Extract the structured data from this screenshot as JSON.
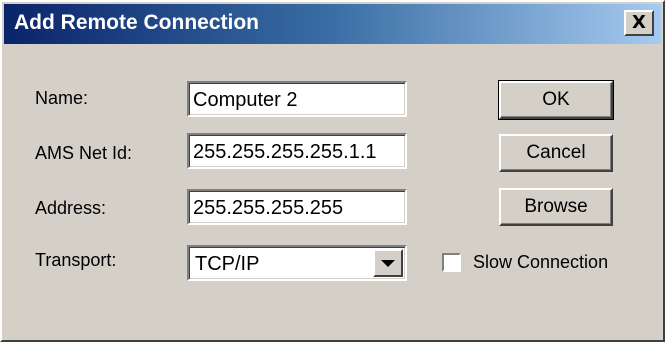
{
  "window": {
    "title": "Add Remote Connection",
    "close_glyph": "X"
  },
  "form": {
    "name_label": "Name:",
    "name_value": "Computer 2",
    "ams_label": "AMS Net Id:",
    "ams_value": "255.255.255.255.1.1",
    "address_label": "Address:",
    "address_value": "255.255.255.255",
    "transport_label": "Transport:",
    "transport_value": "TCP/IP"
  },
  "buttons": {
    "ok": "OK",
    "cancel": "Cancel",
    "browse": "Browse"
  },
  "options": {
    "slow_connection_label": "Slow Connection",
    "slow_connection_checked": false
  },
  "colors": {
    "title_start": "#0a246a",
    "title_end": "#a6caf0",
    "face": "#d4d0c8"
  }
}
